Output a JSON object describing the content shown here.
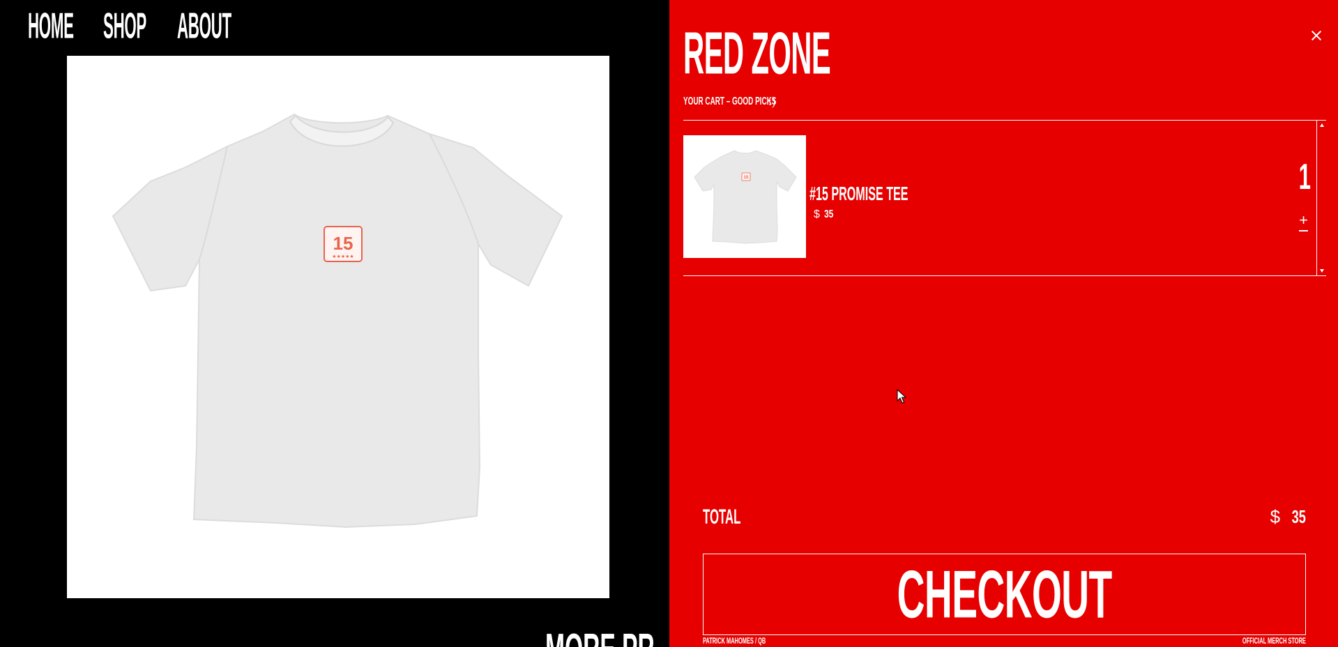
{
  "nav": {
    "home": "HOME",
    "shop": "SHOP",
    "about": "ABOUT"
  },
  "product": {
    "image_icon": "tshirt-15-icon",
    "graphic_number": "15"
  },
  "more_products_text": "MORE PR",
  "cart": {
    "title": "RED ZONE",
    "subtitle_main": "YOUR CART – GOOD PICKS",
    "subtitle_emoticon": ":)",
    "items": [
      {
        "name": "#15 PROMISE TEE",
        "currency": "$",
        "price": "35",
        "quantity": "1",
        "plus": "+"
      }
    ],
    "total_label": "TOTAL",
    "total_currency": "$",
    "total_value": "35",
    "checkout_label": "CHECKOUT",
    "footer_left": "PATRICK MAHOMES / QB",
    "footer_right": "OFFICIAL MERCH STORE"
  },
  "colors": {
    "drawer_bg": "#e60000",
    "page_bg": "#000000",
    "text": "#ffffff",
    "graphic_accent": "#e8634c"
  }
}
